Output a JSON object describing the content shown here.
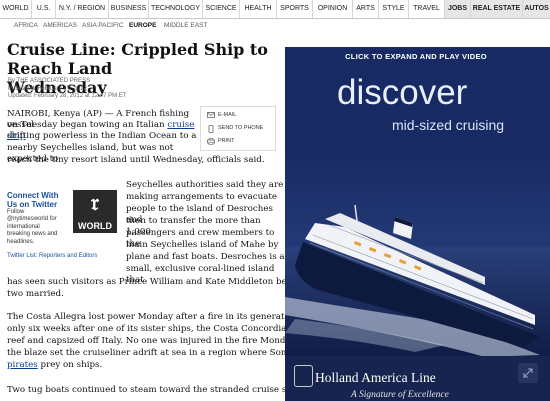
{
  "nav": {
    "tabs": [
      {
        "label": "WORLD",
        "bold": false,
        "shade": false
      },
      {
        "label": "U.S.",
        "bold": false,
        "shade": false
      },
      {
        "label": "N.Y. / REGION",
        "bold": false,
        "shade": false
      },
      {
        "label": "BUSINESS",
        "bold": false,
        "shade": false
      },
      {
        "label": "TECHNOLOGY",
        "bold": false,
        "shade": false
      },
      {
        "label": "SCIENCE",
        "bold": false,
        "shade": false
      },
      {
        "label": "HEALTH",
        "bold": false,
        "shade": false
      },
      {
        "label": "SPORTS",
        "bold": false,
        "shade": false
      },
      {
        "label": "OPINION",
        "bold": false,
        "shade": false
      },
      {
        "label": "ARTS",
        "bold": false,
        "shade": false
      },
      {
        "label": "STYLE",
        "bold": false,
        "shade": false
      },
      {
        "label": "TRAVEL",
        "bold": false,
        "shade": false
      },
      {
        "label": "JOBS",
        "bold": true,
        "shade": true
      },
      {
        "label": "REAL ESTATE",
        "bold": true,
        "shade": true
      },
      {
        "label": "AUTOS",
        "bold": true,
        "shade": true
      }
    ],
    "subnav": [
      "AFRICA",
      "AMERICAS",
      "ASIA PACIFIC",
      "EUROPE",
      "MIDDLE EAST"
    ],
    "subnav_active": "EUROPE"
  },
  "article": {
    "headline_line1": "Cruise Line: Crippled Ship to Reach Land",
    "headline_line2": "Wednesday",
    "byline": "By THE ASSOCIATED PRESS",
    "published": "Published: February 27, 2012",
    "updated": "Updated: February 28, 2012 at 12:47 PM ET",
    "p1_line1": "NAIROBI, Kenya (AP) — A French fishing vessel",
    "p1_line2_a": "on Tuesday began towing an Italian ",
    "p1_link": "cruise ship",
    "p1_line3": "drifting powerless in the Indian Ocean to a",
    "p1_line4": "nearby Seychelles island, but was not expected to",
    "p1_line5": "reach the tiny resort island until Wednesday, officials said.",
    "p2_lines": [
      "Seychelles authorities said they are",
      "making arrangements to evacuate",
      "people to the island of Desroches and",
      "then to transfer the more than 1,000",
      "passengers and crew members to the",
      "main Seychelles island of Mahe by",
      "plane and fast boats. Desroches is a",
      "small, exclusive coral-lined island that",
      "has seen such visitors as Prince William and Kate Middleton before the",
      "two married."
    ],
    "p3_lines": [
      "The Costa Allegra lost power Monday after a fire in its generator room",
      "only six weeks after one of its sister ships, the Costa Concordia, hit a",
      "reef and capsized off Italy. No one was injured in the fire Monday, but",
      "the blaze set the cruiseliner adrift at sea in a region where Somali"
    ],
    "p3_link": "pirates",
    "p3_tail": " prey on ships.",
    "p4_line": "Two tug boats continued to steam toward the stranded cruise ship on"
  },
  "share": {
    "email": "E-MAIL",
    "send_to_phone": "SEND TO PHONE",
    "print": "PRINT"
  },
  "connect": {
    "title_line1": "Connect With",
    "title_line2": "Us on Twitter",
    "text_lines": [
      "Follow",
      "@nytimesworld for",
      "international",
      "breaking news and",
      "headlines."
    ],
    "twitter_list": "Twitter List: Reporters and Editors",
    "world_label": "WORLD"
  },
  "ad": {
    "cta": "CLICK TO EXPAND AND PLAY VIDEO",
    "headline": "discover",
    "subheadline": "mid-sized cruising",
    "brand": "Holland America Line",
    "tagline": "A Signature of Excellence",
    "colors": {
      "sky": "#182a63",
      "sea": "#1b2f6b",
      "hull": "#0d1a3d"
    }
  }
}
